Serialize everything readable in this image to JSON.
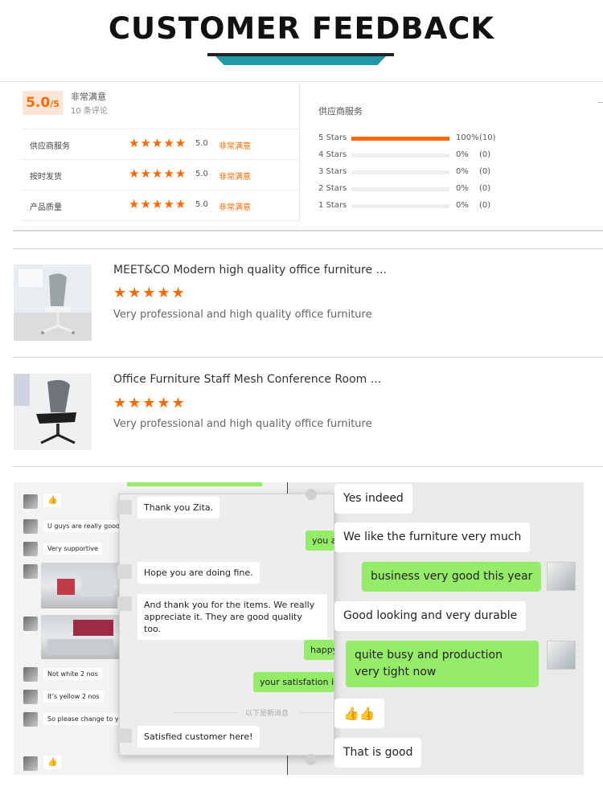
{
  "header": {
    "title": "CUSTOMER FEEDBACK",
    "accent_color": "#1f9aa6"
  },
  "rating": {
    "score": "5.0",
    "score_max": "/5",
    "satisfaction": "非常满意",
    "review_count": "10 条评论",
    "accent_color": "#ff6a00",
    "criteria": [
      {
        "label": "供应商服务",
        "stars": "★★★★★",
        "rating": 5,
        "score": "5.0",
        "verdict": "非常满意"
      },
      {
        "label": "按时发货",
        "stars": "★★★★★",
        "rating": 5,
        "score": "5.0",
        "verdict": "非常满意"
      },
      {
        "label": "产品质量",
        "stars": "★★★★★",
        "rating": 5,
        "score": "5.0",
        "verdict": "非常满意"
      }
    ],
    "distribution_title": "供应商服务",
    "distribution": [
      {
        "label": "5 Stars",
        "fraction": 1.0,
        "percent": "100%",
        "count": "(10)"
      },
      {
        "label": "4 Stars",
        "fraction": 0,
        "percent": "0%",
        "count": "(0)"
      },
      {
        "label": "3 Stars",
        "fraction": 0,
        "percent": "0%",
        "count": "(0)"
      },
      {
        "label": "2 Stars",
        "fraction": 0,
        "percent": "0%",
        "count": "(0)"
      },
      {
        "label": "1 Stars",
        "fraction": 0,
        "percent": "0%",
        "count": "(0)"
      }
    ]
  },
  "reviews": [
    {
      "title": "MEET&CO Modern high quality office furniture ...",
      "stars": "★★★★★",
      "rating": 5,
      "text": "Very professional and high quality office furniture"
    },
    {
      "title": "Office Furniture Staff Mesh Conference Room ...",
      "stars": "★★★★★",
      "rating": 5,
      "text": "Very professional and high quality office furniture"
    }
  ],
  "chat": {
    "left_messages": [
      "U guys are really good",
      "Very supportive",
      "Not white 2 nos",
      "It’s yellow 2 nos",
      "So please change to ye"
    ],
    "thumbs": "👍",
    "popup": {
      "msg1": "Thank you Zita.",
      "green1": "you a",
      "msg2": "Hope you are doing fine.",
      "msg3": "And thank you for the items. We really appreciate it. They are good quality too.",
      "green2": "happy",
      "green3": "your satisfation is",
      "new_messages": "以下是新消息",
      "msg4": "Satisfied customer here!"
    },
    "right": {
      "msg1": "Yes indeed",
      "msg2": "We like the furniture very much",
      "green1": "business very good this year",
      "msg3": "Good looking and very durable",
      "green2": "quite busy and production very tight now",
      "thumbs": "👍👍",
      "msg4": "That is good"
    }
  }
}
